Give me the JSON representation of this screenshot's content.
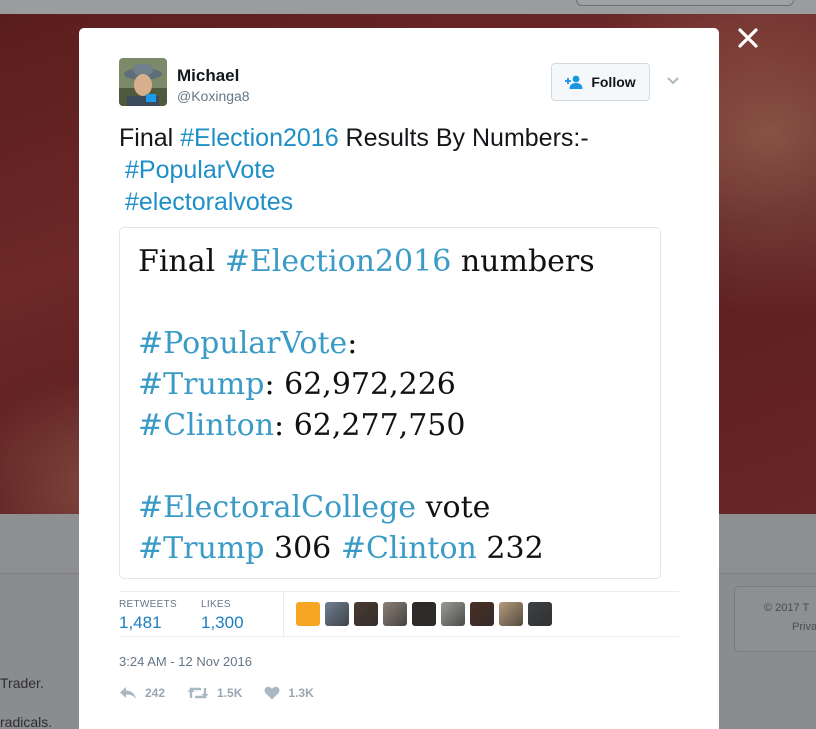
{
  "background": {
    "side_text": [
      "Trader.",
      "radicals."
    ],
    "footer_lines": [
      "© 2017 T",
      "Priva"
    ]
  },
  "tweet": {
    "author_name": "Michael",
    "author_handle": "@Koxinga8",
    "follow_label": "Follow",
    "text_lines": [
      [
        {
          "t": "Final ",
          "tag": false
        },
        {
          "t": "#Election2016",
          "tag": true
        },
        {
          "t": " Results By Numbers:-",
          "tag": false
        }
      ],
      [
        {
          "t": "#PopularVote",
          "tag": true
        }
      ],
      [
        {
          "t": "#electoralvotes",
          "tag": true
        }
      ]
    ],
    "media_lines": [
      [
        {
          "t": "Final ",
          "tag": false
        },
        {
          "t": "#Election2016",
          "tag": true
        },
        {
          "t": " numbers",
          "tag": false
        }
      ],
      [
        {
          "t": "#PopularVote",
          "tag": true
        },
        {
          "t": ":",
          "tag": false
        }
      ],
      [
        {
          "t": "#Trump",
          "tag": true
        },
        {
          "t": ":  62,972,226",
          "tag": false
        }
      ],
      [
        {
          "t": "#Clinton",
          "tag": true
        },
        {
          "t": ": 62,277,750",
          "tag": false
        }
      ],
      [
        {
          "t": "#ElectoralCollege",
          "tag": true
        },
        {
          "t": " vote",
          "tag": false
        }
      ],
      [
        {
          "t": "#Trump",
          "tag": true
        },
        {
          "t": " 306 ",
          "tag": false
        },
        {
          "t": "#Clinton",
          "tag": true
        },
        {
          "t": " 232",
          "tag": false
        }
      ]
    ],
    "retweets_label": "RETWEETS",
    "retweets_count": "1,481",
    "likes_label": "LIKES",
    "likes_count": "1,300",
    "timestamp": "3:24 AM - 12 Nov 2016",
    "reply_count": "242",
    "retweet_count_short": "1.5K",
    "like_count_short": "1.3K"
  },
  "likers": [
    "#f6a623",
    "#6f7f93",
    "#4a3a30",
    "#8a7f76",
    "#2f2a26",
    "#9a9a96",
    "#4a2e24",
    "#b79a7a",
    "#3d4044"
  ],
  "colors": {
    "hashtag": "#1e8fc7",
    "media_hashtag": "#3a9bc6",
    "stat_value": "#1b7fc1",
    "muted": "#657786"
  },
  "icons": {
    "close": "close-icon",
    "follow": "person-add-icon",
    "caret": "chevron-down-icon",
    "reply": "reply-icon",
    "retweet": "retweet-icon",
    "like": "heart-icon"
  }
}
